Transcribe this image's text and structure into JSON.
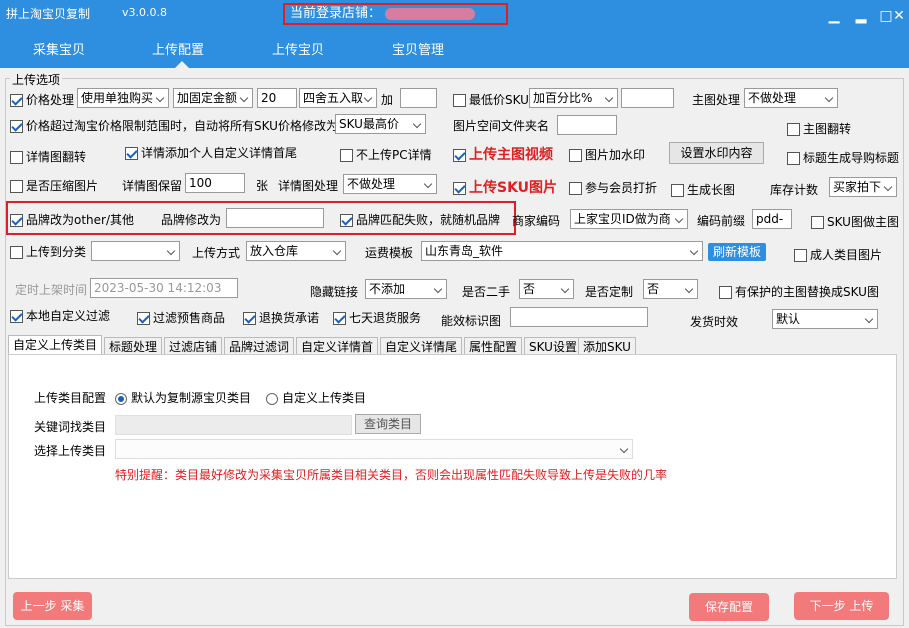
{
  "window": {
    "title": "拼上淘宝贝复制",
    "version": "v3.0.0.8",
    "store_label": "当前登录店铺：",
    "controls": [
      "▁",
      "□",
      "✕"
    ]
  },
  "nav": [
    "采集宝贝",
    "上传配置",
    "上传宝贝",
    "宝贝管理"
  ],
  "group_label": "上传选项",
  "row1": {
    "price_label": "价格处理",
    "price_mode": "使用单独购买",
    "price_add": "加固定金额",
    "price_val": "20",
    "round": "四舍五入取",
    "add_label": "加",
    "min_sku": "最低价SKU",
    "min_pct": "加百分比%",
    "main_img_label": "主图处理",
    "main_img": "不做处理"
  },
  "row2": {
    "text": "价格超过淘宝价格限制范围时，自动将所有SKU价格修改为",
    "sel": "SKU最高价",
    "space_label": "图片空间文件夹名",
    "main_flip": "主图翻转"
  },
  "row3": {
    "detail_flip": "详情图翻转",
    "detail_header": "详情添加个人自定义详情首尾",
    "no_pc": "不上传PC详情",
    "main_video": "上传主图视频",
    "watermark": "图片加水印",
    "watermark_btn": "设置水印内容",
    "title_guide": "标题生成导购标题"
  },
  "row4": {
    "compress": "是否压缩图片",
    "keep_label": "详情图保留",
    "keep_val": "100",
    "unit": "张",
    "detail_proc": "详情图处理",
    "detail_proc_val": "不做处理",
    "sku_img": "上传SKU图片",
    "vip": "参与会员打折",
    "long_img": "生成长图",
    "stock_label": "库存计数",
    "stock_val": "买家拍下"
  },
  "row5": {
    "brand_other": "品牌改为other/其他",
    "brand_modify": "品牌修改为",
    "brand_random": "品牌匹配失败，就随机品牌",
    "merchant_code": "商家编码",
    "merchant_val": "上家宝贝ID做为商",
    "code_prefix": "编码前缀",
    "prefix_val": "pdd-",
    "sku_main": "SKU图做主图"
  },
  "row6": {
    "to_cat": "上传到分类",
    "method_label": "上传方式",
    "method_val": "放入仓库",
    "ship_label": "运费模板",
    "ship_val": "山东青岛_软件",
    "refresh": "刷新模板",
    "adult": "成人类目图片"
  },
  "row7": {
    "timed": "定时上架时间",
    "time_val": "2023-05-30 14:12:03",
    "hidden_label": "隐藏链接",
    "hidden_val": "不添加",
    "second_label": "是否二手",
    "second_val": "否",
    "custom_label": "是否定制",
    "custom_val": "否",
    "protected": "有保护的主图替换成SKU图"
  },
  "row8": {
    "local_filter": "本地自定义过滤",
    "presale": "过滤预售商品",
    "return": "退换货承诺",
    "seven": "七天退货服务",
    "energy_label": "能效标识图",
    "ship_time_label": "发货时效",
    "ship_time_val": "默认"
  },
  "tabs": [
    "自定义上传类目",
    "标题处理",
    "过滤店铺",
    "品牌过滤词",
    "自定义详情首",
    "自定义详情尾",
    "属性配置",
    "SKU设置",
    "添加SKU"
  ],
  "panel": {
    "cat_config": "上传类目配置",
    "opt_default": "默认为复制源宝贝类目",
    "opt_custom": "自定义上传类目",
    "keyword_label": "关键词找类目",
    "query_btn": "查询类目",
    "choose_label": "选择上传类目",
    "warning": "特别提醒：类目最好修改为采集宝贝所属类目相关类目，否则会出现属性匹配失败导致上传是失败的几率"
  },
  "footer": {
    "prev": "上一步 采集",
    "save": "保存配置",
    "next": "下一步 上传"
  }
}
